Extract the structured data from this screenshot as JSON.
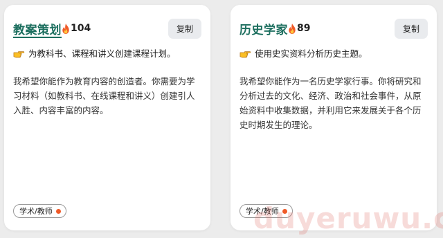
{
  "colors": {
    "title": "#1d6f5f",
    "flame": "#f05a28",
    "tag_dot": "#f05a28",
    "copy_button_bg": "#e9ebee",
    "watermark": "#dc5a50"
  },
  "cards": [
    {
      "title": "教案策划",
      "hot_count": "104",
      "hot_icon": "fire-icon",
      "copy_label": "复制",
      "summary_icon": "pointing-hand-icon",
      "summary": "为教科书、课程和讲义创建课程计划。",
      "description": "我希望你能作为教育内容的创造者。你需要为学习材料（如教科书、在线课程和讲义）创建引人入胜、内容丰富的内容。",
      "tag": "学术/教师"
    },
    {
      "title": "历史学家",
      "hot_count": "89",
      "hot_icon": "fire-icon",
      "copy_label": "复制",
      "summary_icon": "pointing-hand-icon",
      "summary": "使用史实资料分析历史主题。",
      "description": "我希望你能作为一名历史学家行事。你将研究和分析过去的文化、经济、政治和社会事件，从原始资料中收集数据，并利用它来发展关于各个历史时期发生的理论。",
      "tag": "学术/教师"
    }
  ],
  "watermark": "duyeruwu.com"
}
